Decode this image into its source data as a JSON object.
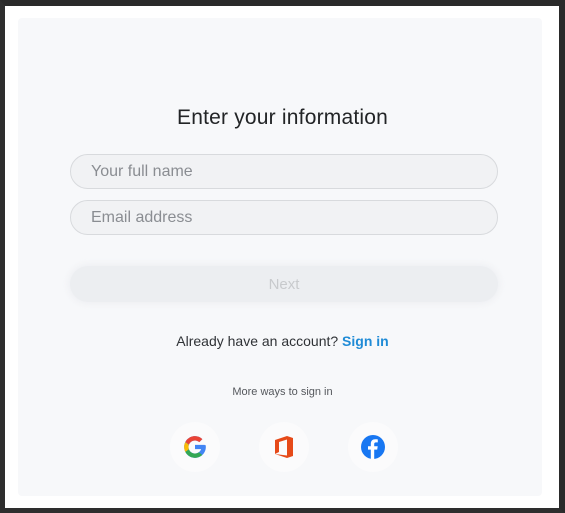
{
  "form": {
    "title": "Enter your information",
    "name_placeholder": "Your full name",
    "email_placeholder": "Email address",
    "next_label": "Next"
  },
  "account": {
    "prompt": "Already have an account?",
    "signin_label": "Sign in"
  },
  "more_ways": {
    "label": "More ways to sign in",
    "providers": [
      {
        "icon": "google-icon"
      },
      {
        "icon": "office-icon"
      },
      {
        "icon": "facebook-icon"
      }
    ]
  },
  "colors": {
    "link": "#1f8bd6",
    "google_blue": "#4285f4",
    "google_red": "#ea4335",
    "google_yellow": "#fbbc05",
    "google_green": "#34a853",
    "office_orange": "#e64a19",
    "facebook_blue": "#1877f2"
  }
}
